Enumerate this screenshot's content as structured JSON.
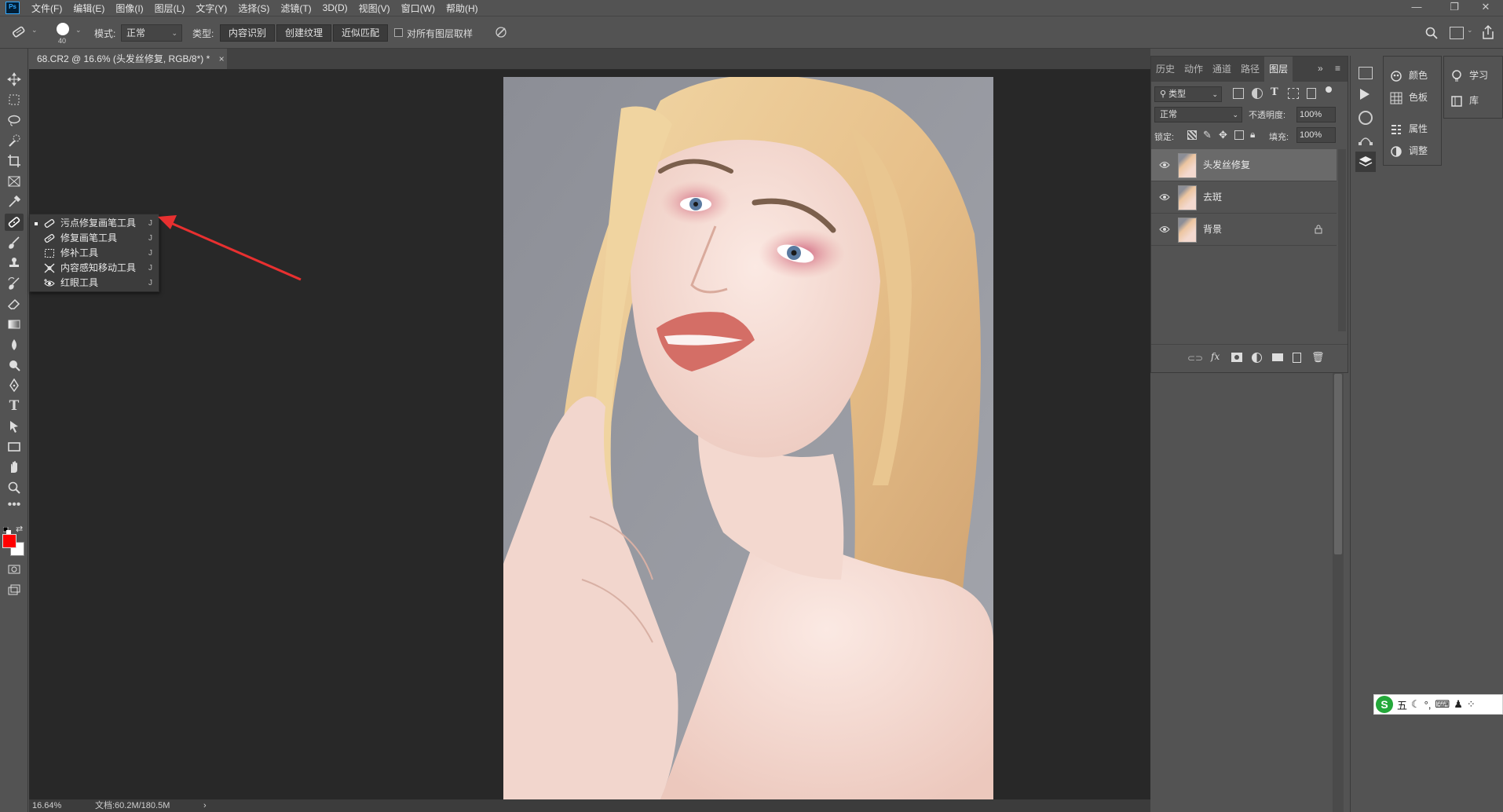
{
  "app": {
    "logo": "Ps"
  },
  "menu": [
    "文件(F)",
    "编辑(E)",
    "图像(I)",
    "图层(L)",
    "文字(Y)",
    "选择(S)",
    "滤镜(T)",
    "3D(D)",
    "视图(V)",
    "窗口(W)",
    "帮助(H)"
  ],
  "window_controls": [
    "—",
    "❐",
    "✕"
  ],
  "options": {
    "brush_size": "40",
    "mode_label": "模式:",
    "mode_value": "正常",
    "type_label": "类型:",
    "type_buttons": [
      "内容识别",
      "创建纹理",
      "近似匹配"
    ],
    "sample_all_label": "对所有图层取样"
  },
  "document": {
    "tab_title": "68.CR2 @ 16.6% (头发丝修复, RGB/8*) *",
    "close": "×"
  },
  "status": {
    "zoom": "16.64%",
    "doc_size": "文档:60.2M/180.5M",
    "arrow": "›"
  },
  "flyout": {
    "items": [
      {
        "label": "污点修复画笔工具",
        "key": "J",
        "icon": "spot-healing-icon",
        "active": true
      },
      {
        "label": "修复画笔工具",
        "key": "J",
        "icon": "healing-brush-icon"
      },
      {
        "label": "修补工具",
        "key": "J",
        "icon": "patch-icon"
      },
      {
        "label": "内容感知移动工具",
        "key": "J",
        "icon": "content-aware-move-icon"
      },
      {
        "label": "红眼工具",
        "key": "J",
        "icon": "red-eye-icon"
      }
    ]
  },
  "layers_panel": {
    "tabs": [
      "历史",
      "动作",
      "通道",
      "路径",
      "图层"
    ],
    "active_tab": "图层",
    "filter_kind": "类型",
    "blend_mode": "正常",
    "opacity_label": "不透明度:",
    "opacity_value": "100%",
    "lock_label": "锁定:",
    "fill_label": "填充:",
    "fill_value": "100%",
    "layers": [
      {
        "name": "头发丝修复",
        "selected": true,
        "locked": false
      },
      {
        "name": "去斑",
        "selected": false,
        "locked": false
      },
      {
        "name": "背景",
        "selected": false,
        "locked": true
      }
    ]
  },
  "side_panels": {
    "group1": [
      "颜色",
      "色板",
      "属性",
      "调整"
    ],
    "group2": [
      "学习",
      "库"
    ]
  },
  "ime": {
    "label": "五"
  },
  "colors": {
    "foreground": "#ff0000",
    "background": "#ffffff",
    "accent_arrow": "#e83030"
  }
}
